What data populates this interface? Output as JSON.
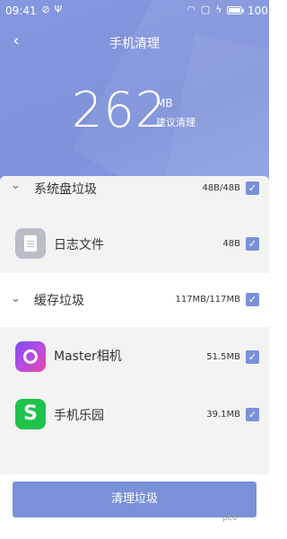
{
  "status_bar": {
    "time": "09:41",
    "battery": "100"
  },
  "nav": {
    "title": "手机清理"
  },
  "summary": {
    "size": "262",
    "unit": "MB",
    "label": "建议清理"
  },
  "categories": [
    {
      "label": "系统盘垃圾",
      "size": "48B/48B",
      "checked": true
    },
    {
      "label": "缓存垃圾",
      "size": "117MB/117MB",
      "checked": true
    }
  ],
  "items": [
    {
      "label": "日志文件",
      "size": "48B",
      "icon": "log-file-icon",
      "checked": true
    },
    {
      "label": "Master相机",
      "size": "51.5MB",
      "icon": "master-camera-app-icon",
      "checked": true
    },
    {
      "label": "手机乐园",
      "size": "39.1MB",
      "icon": "phone-park-app-icon",
      "checked": true
    }
  ],
  "clean_button": {
    "label": "清理垃圾"
  },
  "watermark": "pc6"
}
